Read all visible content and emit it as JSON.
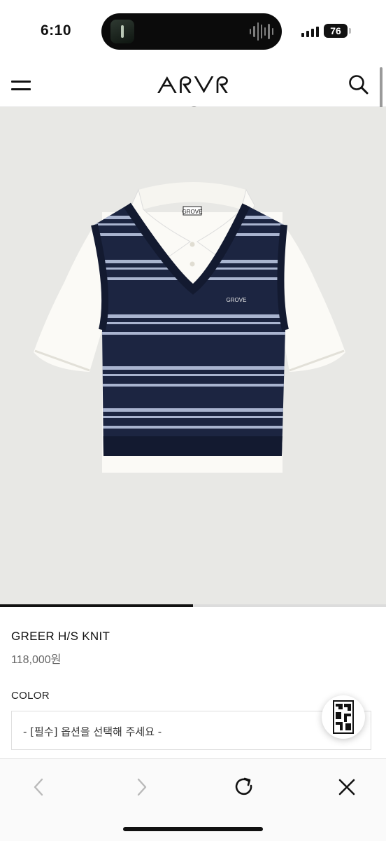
{
  "status_bar": {
    "time": "6:10",
    "battery": "76"
  },
  "header": {
    "logo": "ᗅᖇᐯᖇ ᗅᖇOᐯE"
  },
  "carousel": {
    "progress": 0.5
  },
  "product": {
    "name": "GREER H/S KNIT",
    "price": "118,000원",
    "garment_logo": "GROVE"
  },
  "options": {
    "color_label": "COLOR",
    "color_select_placeholder": "- [필수] 옵션을 선택해 주세요 -"
  },
  "colors": {
    "accent": "#111111",
    "navy": "#1c2541",
    "stripe": "#a9b4cf",
    "background": "#e8e8e5"
  },
  "icons": [
    "menu-icon",
    "search-icon",
    "brand-badge-icon",
    "back-icon",
    "forward-icon",
    "reload-icon",
    "close-icon"
  ]
}
